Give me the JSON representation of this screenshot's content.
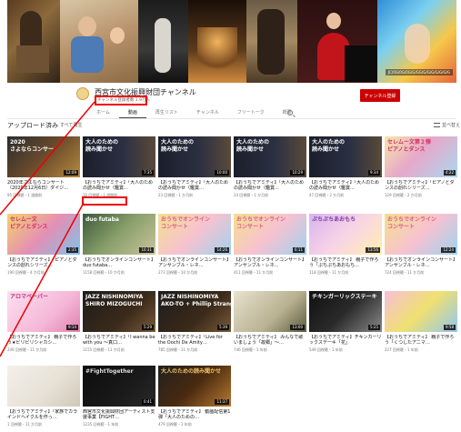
{
  "banner": {
    "corner_text": "JC/0G/0G/0G/G/GG/G/G/G/G/G/G/G"
  },
  "channel": {
    "name": "西宮市文化振興財団チャンネル",
    "subscribers": "チャンネル登録者数 1.9万人",
    "subscribe_label": "チャンネル登録"
  },
  "tabs": [
    {
      "label": "ホーム"
    },
    {
      "label": "動画"
    },
    {
      "label": "再生リスト"
    },
    {
      "label": "チャンネル"
    },
    {
      "label": "フリートーク"
    },
    {
      "label": "概要"
    }
  ],
  "section": {
    "title": "アップロード済み",
    "play_all": "すべて再生",
    "sort_label": "並べ替え"
  },
  "videos": [
    {
      "title": "2020年さよならコンサート（2020年12月6日）ダイジ…",
      "meta": "95 回視聴・1 週間前",
      "duration": "12:09",
      "thumb_text": "2020",
      "thumb_text2": "さよならコンサー"
    },
    {
      "title": "【おうちでアミティ】「大人のための読み聞かせ（鑑賞…",
      "meta": "16 回視聴・1 週間前",
      "duration": "7:35",
      "thumb_text": "大人のための",
      "thumb_text2": "読み聞かせ"
    },
    {
      "title": "【おうちでアミティ】「大人のための読み聞かせ（鑑賞…",
      "meta": "23 回視聴・1 か月前",
      "duration": "10:00",
      "thumb_text": "大人のための",
      "thumb_text2": "読み聞かせ"
    },
    {
      "title": "【おうちでアミティ】「大人のための読み聞かせ（鑑賞…",
      "meta": "24 回視聴・1 か月前",
      "duration": "10:29",
      "thumb_text": "大人のための",
      "thumb_text2": "読み聞かせ"
    },
    {
      "title": "【おうちでアミティ】「大人のための読み聞かせ（鑑賞…",
      "meta": "47 回視聴・2 か月前",
      "duration": "9:34",
      "thumb_text": "大人のための",
      "thumb_text2": "読み聞かせ"
    },
    {
      "title": "【おうちでアミティ】「ピアノとダンスの創れシリーズ…",
      "meta": "129 回視聴・2 か月前",
      "duration": "4:22",
      "thumb_text": "セレムー文第２弾",
      "thumb_text2": "ピアノとダンス"
    },
    {
      "title": "【おうちでアミティ】「ピアノとダンスの創れシリーズ…",
      "meta": "190 回視聴・4 か月前",
      "duration": "2:35",
      "thumb_text": "セレムー文",
      "thumb_text2": "ピアノとダンス"
    },
    {
      "title": "【おうちでオンラインコンサート】duo futaba…",
      "meta": "1158 回視聴・10 か月前",
      "duration": "10:31",
      "thumb_text": "duo futaba",
      "thumb_text2": ""
    },
    {
      "title": "【おうちでオンラインコンサート】アンサンブル・レネ…",
      "meta": "273 回視聴・10 か月前",
      "duration": "14:26",
      "thumb_text": "おうちでオンライン",
      "thumb_text2": "コンサート"
    },
    {
      "title": "【おうちでオンラインコンサート】アンサンブル・レネ…",
      "meta": "411 回視聴・11 か月前",
      "duration": "6:11",
      "thumb_text": "おうちでオンライン",
      "thumb_text2": "コンサート"
    },
    {
      "title": "【おうちでアミティ】 親子で作ろう「ぷちぷちあおもち…",
      "meta": "118 回視聴・11 か月前",
      "duration": "13:56",
      "thumb_text": "ぷちぷちあおもち",
      "thumb_text2": ""
    },
    {
      "title": "【おうちでオンラインコンサート】アンサンブル・レネ…",
      "meta": "724 回視聴・11 か月前",
      "duration": "12:24",
      "thumb_text": "おうちでオンライン",
      "thumb_text2": "コンサート"
    },
    {
      "title": "【おうちでアミティ】 親子で作ろう★ビリビリシャカシ…",
      "meta": "249 回視聴・11 か月前",
      "duration": "9:14",
      "thumb_text": "アロマペーパー",
      "thumb_text2": ""
    },
    {
      "title": "【おうちでアミティ】「I wanna be with you 〜真口…",
      "meta": "1155 回視聴・11 か月前",
      "duration": "5:29",
      "thumb_text": "JAZZ NISHINOMIYA",
      "thumb_text2": "SHIRO MIZOGUCHI"
    },
    {
      "title": "【おうちでアミティ】「Live for the Oochi De Amity…",
      "meta": "785 回視聴・11 か月前",
      "duration": "5:39",
      "thumb_text": "JAZZ NISHINOMIYA",
      "thumb_text2": "AKO-TO + Phillip Strange"
    },
    {
      "title": "【おうちでアミティ】 みんなで歌いましょう「故郷」〜…",
      "meta": "746 回視聴・1 年前",
      "duration": "13:00",
      "thumb_text": "",
      "thumb_text2": ""
    },
    {
      "title": "【おうちでアミティ】チキンカーリックスデーキ「花」",
      "meta": "549 回視聴・1 年前",
      "duration": "5:25",
      "thumb_text": "チキンガーリックステーキ",
      "thumb_text2": ""
    },
    {
      "title": "【おうちでアミティ】 親子で作ろう「くつしたアニマ…",
      "meta": "227 回視聴・1 年前",
      "duration": "9:58",
      "thumb_text": "",
      "thumb_text2": ""
    },
    {
      "title": "【おうちでアミティ】「家族でカラインドヘイクルを作っ…",
      "meta": "1 回視聴・11 か月前",
      "duration": "",
      "thumb_text": "",
      "thumb_text2": ""
    },
    {
      "title": "西宮市文化振興財団アーティスト支援事業【FIGHT…",
      "meta": "1235 回視聴・1 年前",
      "duration": "0:41",
      "thumb_text": "#FightTogether",
      "thumb_text2": ""
    },
    {
      "title": "【おうちでアミティ】 動画配信第1弾「大人のための…",
      "meta": "479 回視聴・1 年前",
      "duration": "11:37",
      "thumb_text": "大人のための読み聞かせ",
      "thumb_text2": ""
    }
  ],
  "colors": {
    "subscribe": "#cc0000",
    "annotation": "#ee0000"
  }
}
